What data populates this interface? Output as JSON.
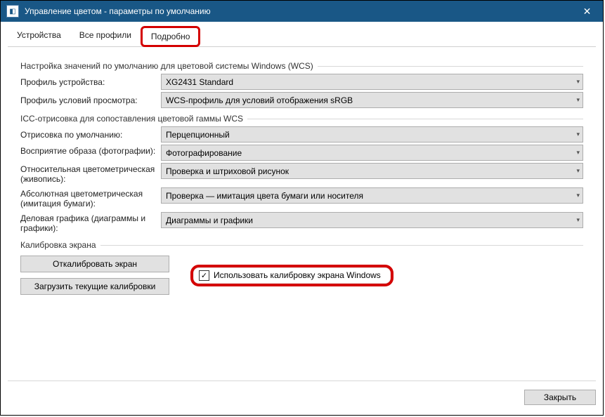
{
  "window": {
    "title": "Управление цветом - параметры по умолчанию"
  },
  "tabs": {
    "devices": "Устройства",
    "all_profiles": "Все профили",
    "advanced": "Подробно"
  },
  "wcs_defaults": {
    "heading": "Настройка значений по умолчанию для цветовой системы Windows (WCS)",
    "device_profile_label": "Профиль устройства:",
    "device_profile_value": "XG2431 Standard",
    "viewing_label": "Профиль условий просмотра:",
    "viewing_value": "WCS-профиль для условий отображения sRGB"
  },
  "icc": {
    "heading": "ICC-отрисовка для сопоставления цветовой гаммы WCS",
    "default_intent_label": "Отрисовка по умолчанию:",
    "default_intent_value": "Перцепционный",
    "perceptual_label": "Восприятие образа (фотографии):",
    "perceptual_value": "Фотографирование",
    "relative_label": "Относительная цветометрическая (живопись):",
    "relative_value": "Проверка и штриховой рисунок",
    "absolute_label": "Абсолютная цветометрическая (имитация бумаги):",
    "absolute_value": "Проверка — имитация цвета бумаги или носителя",
    "business_label": "Деловая графика (диаграммы и графики):",
    "business_value": "Диаграммы и графики"
  },
  "calibration": {
    "heading": "Калибровка экрана",
    "calibrate_btn": "Откалибровать экран",
    "reload_btn": "Загрузить текущие калибровки",
    "use_windows_label": "Использовать калибровку экрана Windows"
  },
  "footer": {
    "close": "Закрыть"
  }
}
